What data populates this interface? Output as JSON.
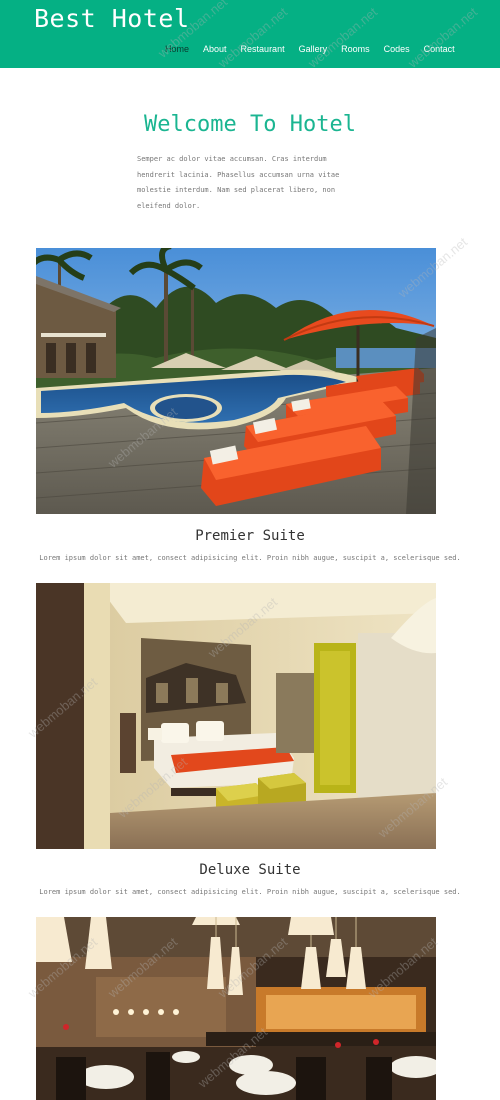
{
  "header": {
    "logo": "Best Hotel",
    "nav": [
      "Home",
      "About",
      "Restaurant",
      "Gallery",
      "Rooms",
      "Codes",
      "Contact"
    ],
    "bg_color": "#05b084"
  },
  "welcome": {
    "title": "Welcome To Hotel",
    "text": "Semper ac dolor vitae accumsan. Cras interdum hendrerit lacinia. Phasellus accumsan urna vitae molestie interdum. Nam sed placerat libero, non eleifend dolor."
  },
  "suites": [
    {
      "title": "Premier Suite",
      "text": "Lorem ipsum dolor sit amet, consect adipisicing elit. Proin nibh augue, suscipit a, scelerisque sed."
    },
    {
      "title": "Deluxe Suite",
      "text": "Lorem ipsum dolor sit amet, consect adipisicing elit. Proin nibh augue, suscipit a, scelerisque sed."
    }
  ],
  "watermark": "webmoban.net"
}
